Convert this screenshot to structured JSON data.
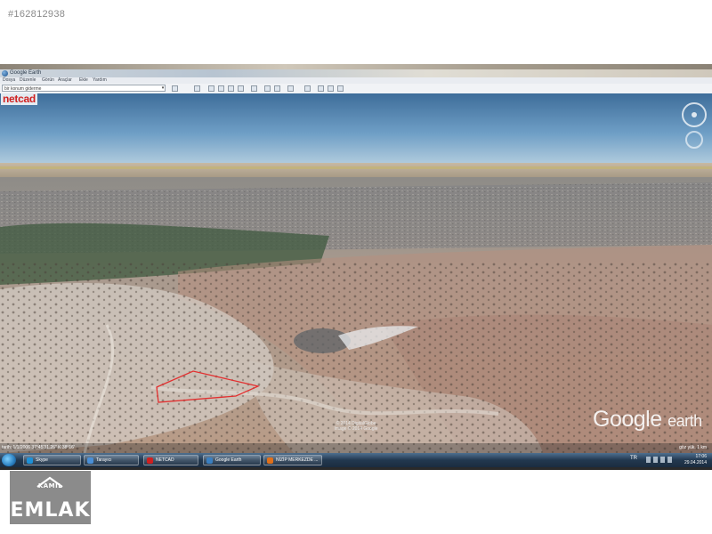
{
  "listing": {
    "id": "#162812938"
  },
  "window": {
    "title": "Google Earth",
    "menu": [
      "Dosya",
      "Düzenle",
      "Görün",
      "Araçlar",
      "Ekle",
      "Yardım"
    ],
    "search_value": "bir konum giderme"
  },
  "overlay": {
    "brand": "netcad",
    "watermark_google": "Google",
    "watermark_earth": "earth",
    "attribution": "© 2014 DigitalGlobe\nImage © 2014 Google"
  },
  "statusbar": {
    "left": "tarih: 1/1/2006  37°45'31.26\" K  38°16'",
    "right": "göz yük. 1 km"
  },
  "taskbar": {
    "items": [
      {
        "label": "Skype",
        "icon_color": "#1e90d6"
      },
      {
        "label": "Tarayıcı",
        "icon_color": "#4a8fd6"
      },
      {
        "label": "NETCAD",
        "icon_color": "#d02020"
      },
      {
        "label": "Google Earth",
        "icon_color": "#3a7fc0"
      },
      {
        "label": "NİZİP MERKEZDE ...",
        "icon_color": "#e0701a"
      }
    ],
    "language": "TR",
    "time": "17:06",
    "date": "29.04.2014"
  },
  "logo": {
    "top": "KAMİL",
    "main": "EMLAK"
  },
  "colors": {
    "parcel_outline": "#e23030",
    "sky_top": "#3f6f9c",
    "ground": "#b59a86"
  }
}
